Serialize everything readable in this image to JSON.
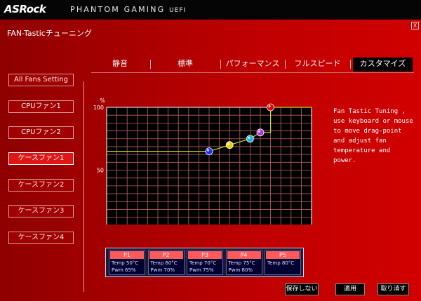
{
  "brand": {
    "logo": "ASRock",
    "subtitle": "PHANTOM GAMING",
    "uefi": "UEFI"
  },
  "window": {
    "title": "FAN-Tasticチューニング",
    "close": "X"
  },
  "side_buttons": [
    "All Fans Setting",
    "CPUファン1",
    "CPUファン2",
    "ケースファン1",
    "ケースファン2",
    "ケースファン3",
    "ケースファン4"
  ],
  "active_side": "ケースファン1",
  "tabs": [
    "静音",
    "標準",
    "パフォーマンス",
    "フルスピード",
    "カスタマイズ"
  ],
  "active_tab": "カスタマイズ",
  "description": "Fan Tastic Tuning , use keyboard or mouse to move drag-point and adjust fan temperature and power.",
  "points": [
    {
      "name": "P1",
      "temp": "Temp 50°C",
      "pwm": "Pwm  65%"
    },
    {
      "name": "P2",
      "temp": "Temp 60°C",
      "pwm": "Pwm  70%"
    },
    {
      "name": "P3",
      "temp": "Temp 70°C",
      "pwm": "Pwm  75%"
    },
    {
      "name": "P4",
      "temp": "Temp 75°C",
      "pwm": "Pwm  80%"
    },
    {
      "name": "P5",
      "temp": "Temp 80°C",
      "pwm": ""
    }
  ],
  "buttons": {
    "discard": "保存しない",
    "apply": "適用",
    "cancel": "取り消す"
  },
  "colors": {
    "point_colors": [
      "#2030ff",
      "#e8d000",
      "#20b0e0",
      "#b030e0",
      "#e00000"
    ],
    "curve": "#c8e020",
    "grid": "#c06060"
  },
  "chart_data": {
    "type": "line",
    "x_unit": "°C",
    "y_unit": "%",
    "xlim": [
      0,
      100
    ],
    "ylim": [
      0,
      100
    ],
    "x_ticks": [
      "0",
      "25",
      "50",
      "75",
      "100"
    ],
    "y_ticks": [
      "100",
      "50"
    ],
    "grid": true,
    "curve": [
      {
        "x": 0,
        "y": 65
      },
      {
        "x": 50,
        "y": 65
      },
      {
        "x": 60,
        "y": 70
      },
      {
        "x": 70,
        "y": 75
      },
      {
        "x": 75,
        "y": 80
      },
      {
        "x": 80,
        "y": 80
      },
      {
        "x": 80,
        "y": 100
      },
      {
        "x": 100,
        "y": 100
      }
    ],
    "points": [
      {
        "name": "P1",
        "x": 50,
        "y": 65
      },
      {
        "name": "P2",
        "x": 60,
        "y": 70
      },
      {
        "name": "P3",
        "x": 70,
        "y": 75
      },
      {
        "name": "P4",
        "x": 75,
        "y": 80
      },
      {
        "name": "P5",
        "x": 80,
        "y": 100
      }
    ]
  }
}
